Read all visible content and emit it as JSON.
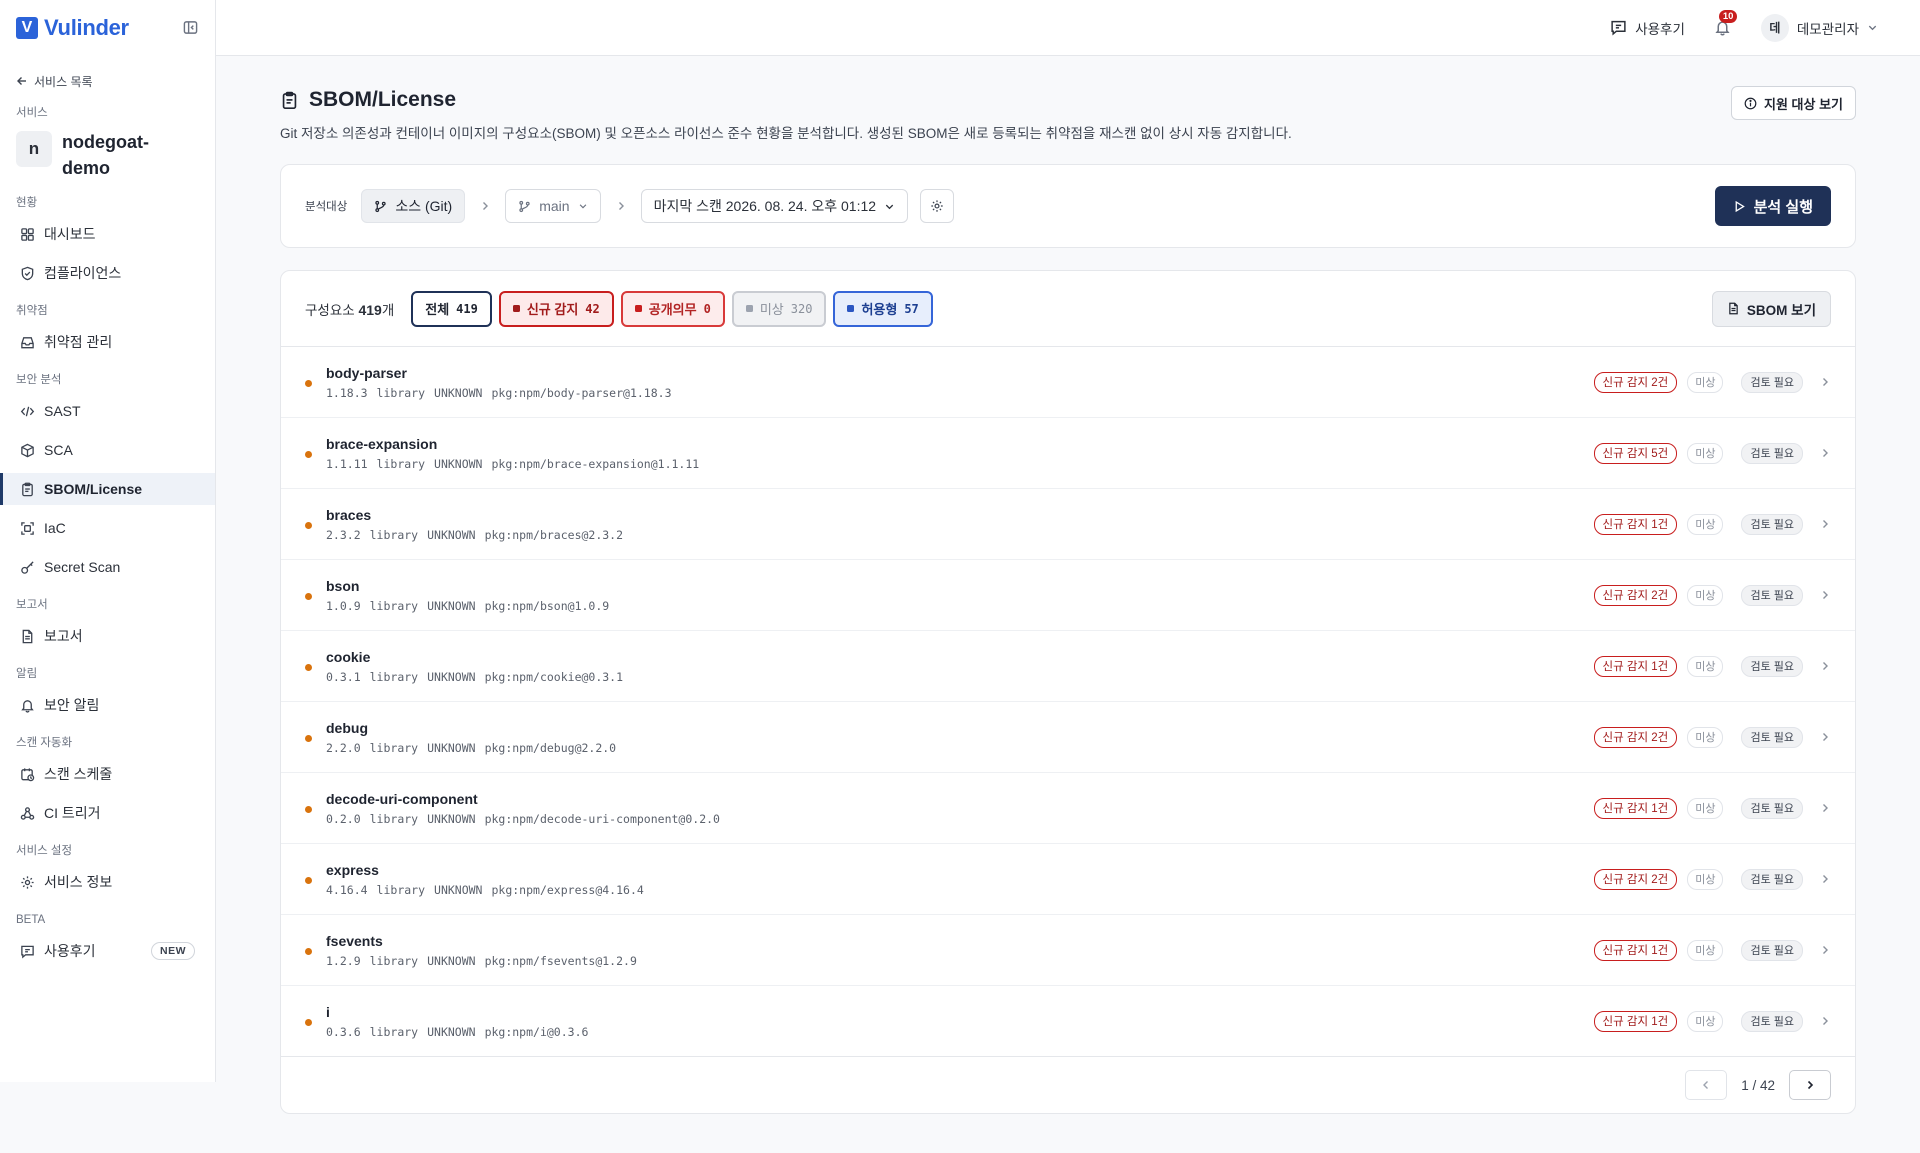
{
  "brand": {
    "letter": "V",
    "name": "Vulinder"
  },
  "sidebar": {
    "back_label": "서비스 목록",
    "service_section": "서비스",
    "service_avatar": "n",
    "service_name": "nodegoat-demo",
    "sections": [
      {
        "label": "현황",
        "items": [
          {
            "label": "대시보드",
            "icon": "dashboard-icon"
          },
          {
            "label": "컴플라이언스",
            "icon": "shield-check-icon"
          }
        ]
      },
      {
        "label": "취약점",
        "items": [
          {
            "label": "취약점 관리",
            "icon": "inbox-icon"
          }
        ]
      },
      {
        "label": "보안 분석",
        "items": [
          {
            "label": "SAST",
            "icon": "code-icon"
          },
          {
            "label": "SCA",
            "icon": "package-icon"
          },
          {
            "label": "SBOM/License",
            "icon": "clipboard-icon",
            "active": true
          },
          {
            "label": "IaC",
            "icon": "scan-icon"
          },
          {
            "label": "Secret Scan",
            "icon": "key-icon"
          }
        ]
      },
      {
        "label": "보고서",
        "items": [
          {
            "label": "보고서",
            "icon": "file-icon"
          }
        ]
      },
      {
        "label": "알림",
        "items": [
          {
            "label": "보안 알림",
            "icon": "bell-icon"
          }
        ]
      },
      {
        "label": "스캔 자동화",
        "items": [
          {
            "label": "스캔 스케줄",
            "icon": "calendar-clock-icon"
          },
          {
            "label": "CI 트리거",
            "icon": "webhook-icon"
          }
        ]
      },
      {
        "label": "서비스 설정",
        "items": [
          {
            "label": "서비스 정보",
            "icon": "gear-icon"
          }
        ]
      },
      {
        "label": "BETA",
        "items": [
          {
            "label": "사용후기",
            "icon": "feedback-icon",
            "badge": "NEW"
          }
        ]
      }
    ]
  },
  "topbar": {
    "feedback_label": "사용후기",
    "notif_count": "10",
    "user_avatar": "데",
    "user_name": "데모관리자"
  },
  "page": {
    "title": "SBOM/License",
    "description": "Git 저장소 의존성과 컨테이너 이미지의 구성요소(SBOM) 및 오픈소스 라이선스 준수 현황을 분석합니다. 생성된 SBOM은 새로 등록되는 취약점을 재스캔 없이 상시 자동 감지합니다.",
    "support_btn": "지원 대상 보기"
  },
  "filter": {
    "label": "분석대상",
    "source": "소스 (Git)",
    "branch": "main",
    "scan": "마지막 스캔 2026. 08. 24. 오후 01:12",
    "run_btn": "분석 실행"
  },
  "list": {
    "count_prefix": "구성요소",
    "count": "419",
    "count_suffix": "개",
    "tabs": {
      "all": {
        "label": "전체",
        "count": "419"
      },
      "new": {
        "label": "신규 감지",
        "count": "42"
      },
      "disc": {
        "label": "공개의무",
        "count": "0"
      },
      "unk": {
        "label": "미상",
        "count": "320"
      },
      "perm": {
        "label": "허용형",
        "count": "57"
      }
    },
    "sbom_btn": "SBOM 보기",
    "tag_unknown": "미상",
    "tag_review": "검토 필요",
    "rows": [
      {
        "name": "body-parser",
        "version": "1.18.3",
        "type": "library",
        "license": "UNKNOWN",
        "purl": "pkg:npm/body-parser@1.18.3",
        "new_tag": "신규 감지 2건"
      },
      {
        "name": "brace-expansion",
        "version": "1.1.11",
        "type": "library",
        "license": "UNKNOWN",
        "purl": "pkg:npm/brace-expansion@1.1.11",
        "new_tag": "신규 감지 5건"
      },
      {
        "name": "braces",
        "version": "2.3.2",
        "type": "library",
        "license": "UNKNOWN",
        "purl": "pkg:npm/braces@2.3.2",
        "new_tag": "신규 감지 1건"
      },
      {
        "name": "bson",
        "version": "1.0.9",
        "type": "library",
        "license": "UNKNOWN",
        "purl": "pkg:npm/bson@1.0.9",
        "new_tag": "신규 감지 2건"
      },
      {
        "name": "cookie",
        "version": "0.3.1",
        "type": "library",
        "license": "UNKNOWN",
        "purl": "pkg:npm/cookie@0.3.1",
        "new_tag": "신규 감지 1건"
      },
      {
        "name": "debug",
        "version": "2.2.0",
        "type": "library",
        "license": "UNKNOWN",
        "purl": "pkg:npm/debug@2.2.0",
        "new_tag": "신규 감지 2건"
      },
      {
        "name": "decode-uri-component",
        "version": "0.2.0",
        "type": "library",
        "license": "UNKNOWN",
        "purl": "pkg:npm/decode-uri-component@0.2.0",
        "new_tag": "신규 감지 1건"
      },
      {
        "name": "express",
        "version": "4.16.4",
        "type": "library",
        "license": "UNKNOWN",
        "purl": "pkg:npm/express@4.16.4",
        "new_tag": "신규 감지 2건"
      },
      {
        "name": "fsevents",
        "version": "1.2.9",
        "type": "library",
        "license": "UNKNOWN",
        "purl": "pkg:npm/fsevents@1.2.9",
        "new_tag": "신규 감지 1건"
      },
      {
        "name": "i",
        "version": "0.3.6",
        "type": "library",
        "license": "UNKNOWN",
        "purl": "pkg:npm/i@0.3.6",
        "new_tag": "신규 감지 1건"
      }
    ]
  },
  "pager": {
    "text": "1 / 42"
  }
}
